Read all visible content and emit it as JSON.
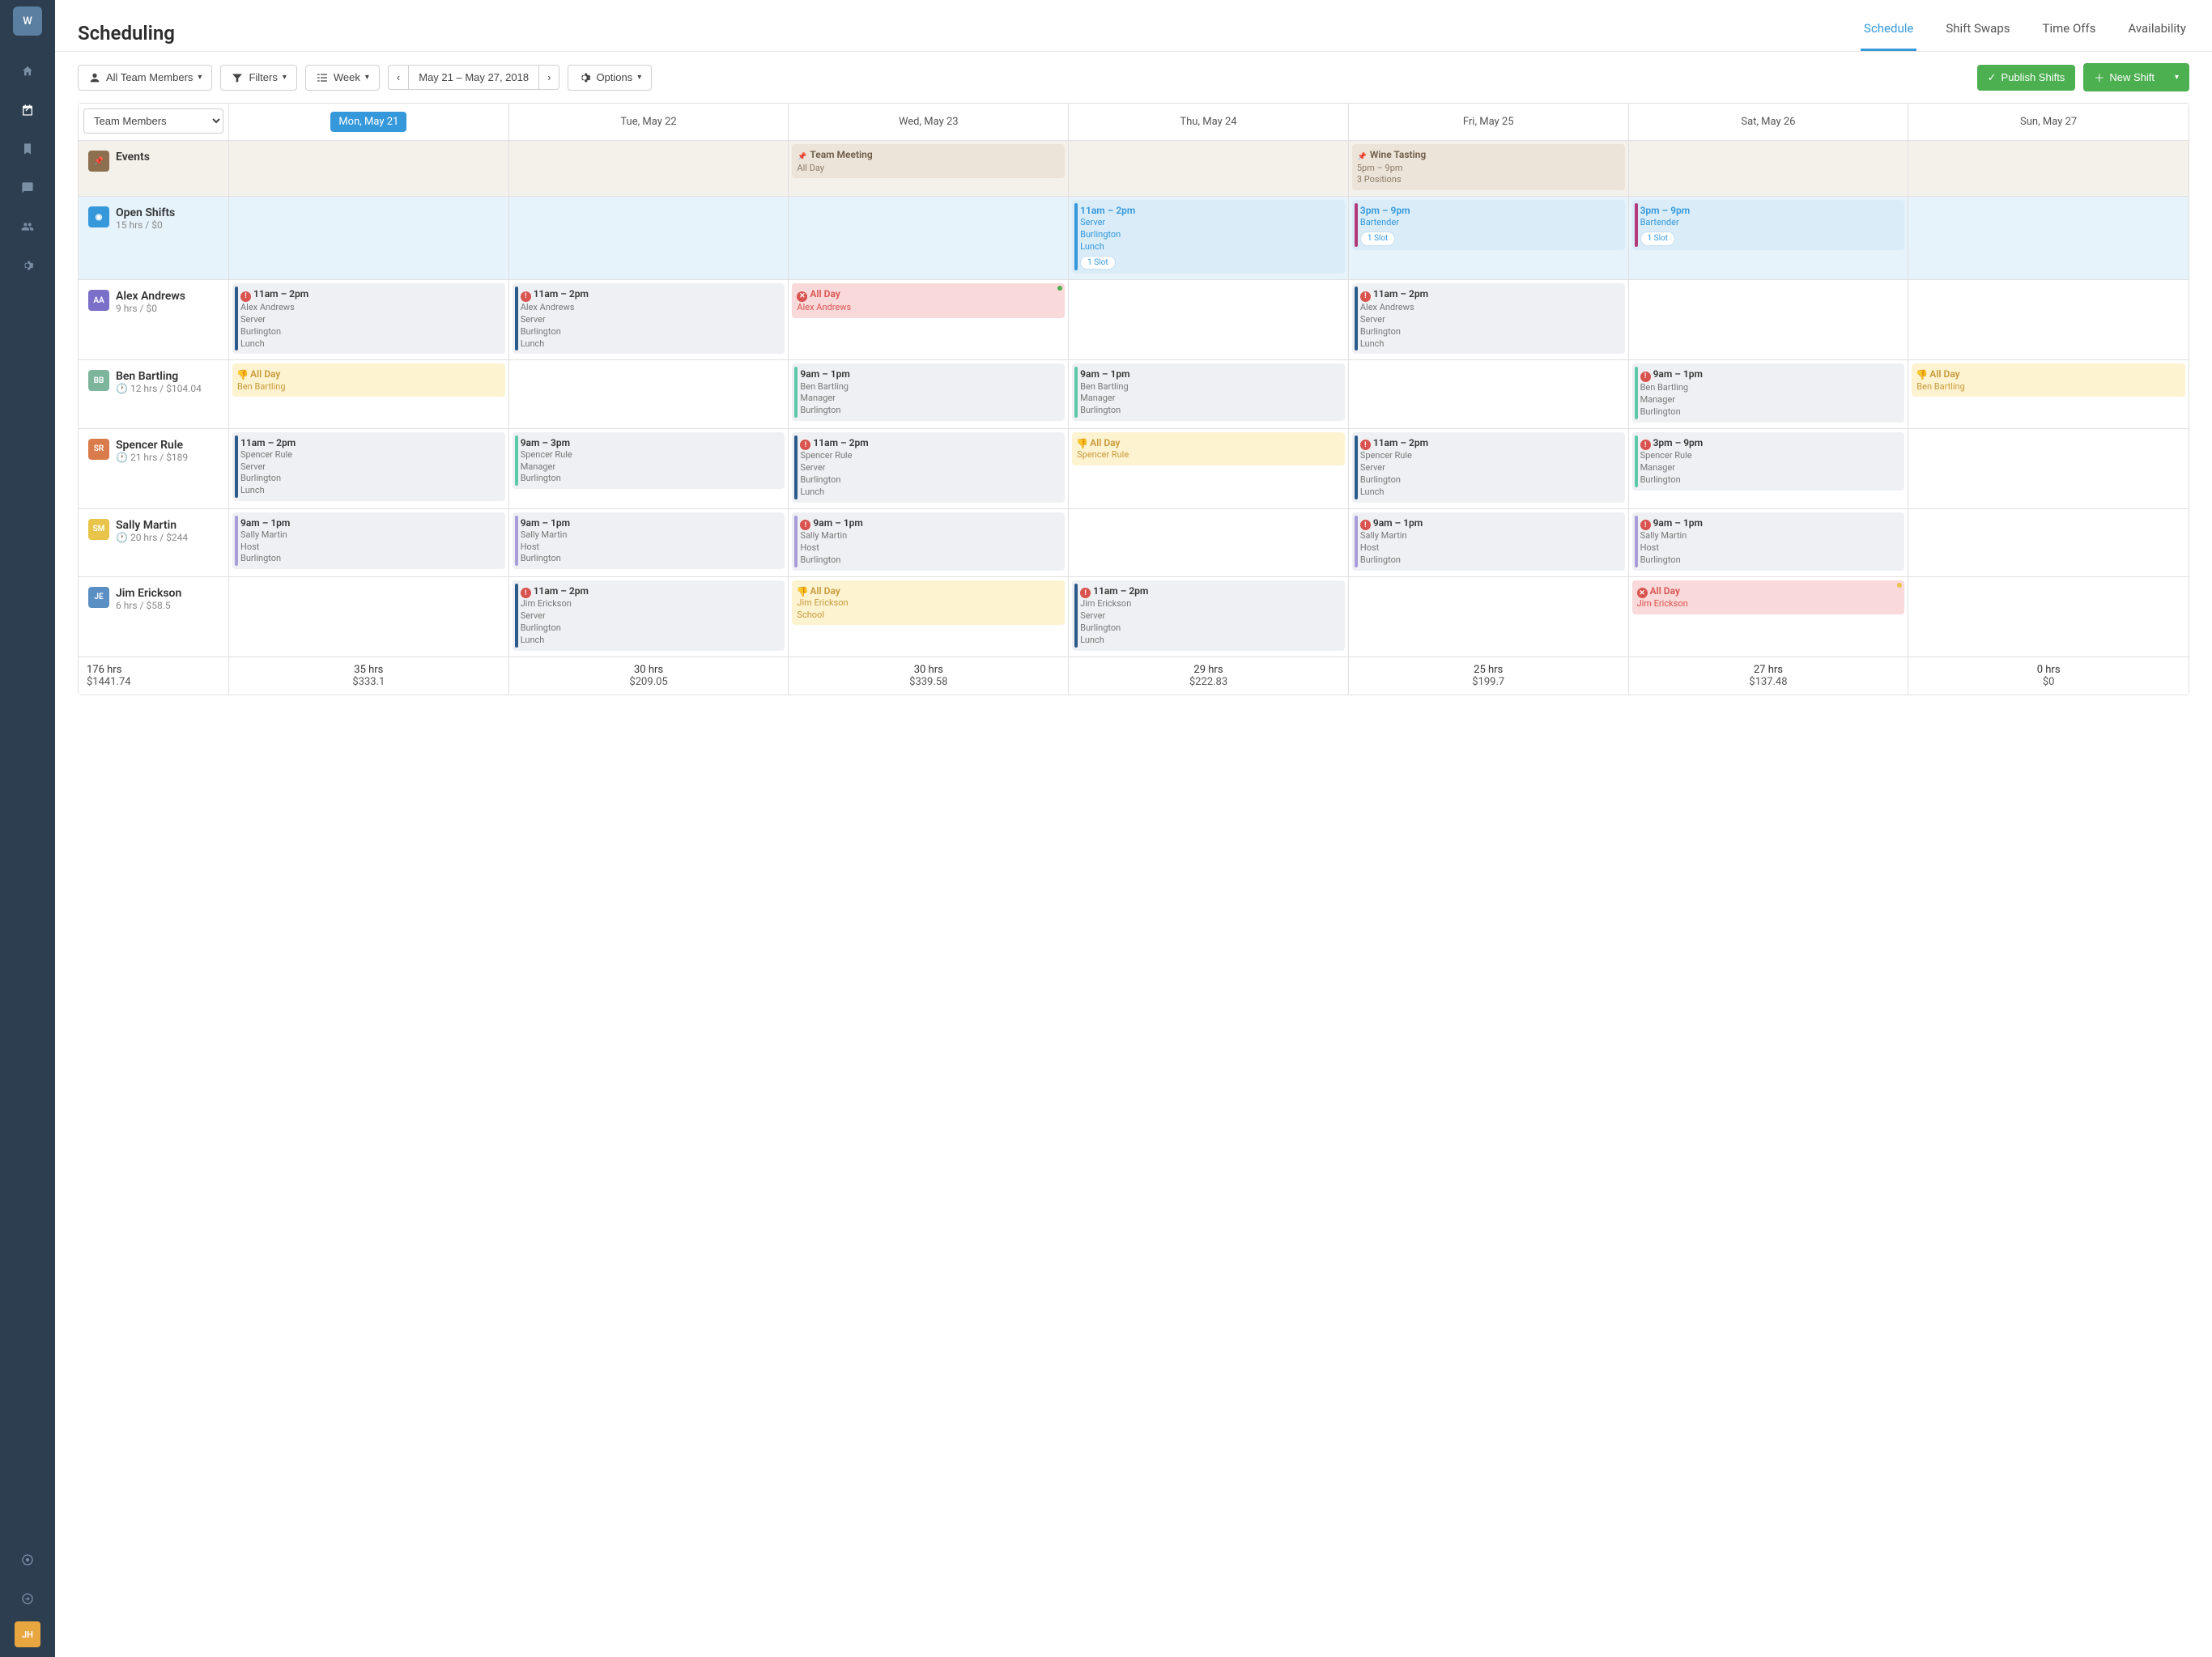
{
  "sidebar": {
    "logo": "W",
    "user_initials": "JH"
  },
  "header": {
    "title": "Scheduling",
    "tabs": [
      "Schedule",
      "Shift Swaps",
      "Time Offs",
      "Availability"
    ],
    "active_tab": 0
  },
  "toolbar": {
    "team_filter": "All Team Members",
    "filters": "Filters",
    "view": "Week",
    "date_range": "May 21 – May 27, 2018",
    "options": "Options",
    "publish": "Publish Shifts",
    "new_shift": "New Shift"
  },
  "columns": {
    "selector": "Team Members",
    "days": [
      "Mon, May 21",
      "Tue, May 22",
      "Wed, May 23",
      "Thu, May 24",
      "Fri, May 25",
      "Sat, May 26",
      "Sun, May 27"
    ],
    "today_index": 0
  },
  "rows": [
    {
      "type": "events",
      "name": "Events",
      "sub": "",
      "cells": [
        null,
        null,
        {
          "style": "brown",
          "noborder": true,
          "icon": "pin",
          "time": "Team Meeting",
          "lines": [
            "All Day"
          ]
        },
        null,
        {
          "style": "brown",
          "noborder": true,
          "icon": "pin",
          "time": "Wine Tasting",
          "lines": [
            "5pm – 9pm",
            "3 Positions"
          ]
        },
        null,
        null
      ]
    },
    {
      "type": "open",
      "name": "Open Shifts",
      "sub": "15 hrs / $0",
      "cells": [
        null,
        null,
        null,
        {
          "style": "blue",
          "bar": "#3498db",
          "time": "11am – 2pm",
          "lines": [
            "Server",
            "Burlington",
            "Lunch"
          ],
          "slot": "1 Slot"
        },
        {
          "style": "blue",
          "bar": "#b23a7a",
          "time": "3pm – 9pm",
          "lines": [
            "Bartender"
          ],
          "slot": "1 Slot"
        },
        {
          "style": "blue",
          "bar": "#b23a7a",
          "time": "3pm – 9pm",
          "lines": [
            "Bartender"
          ],
          "slot": "1 Slot"
        },
        null
      ]
    },
    {
      "type": "member",
      "name": "Alex Andrews",
      "sub": "9 hrs / $0",
      "initials": "AA",
      "color": "#7a6fc9",
      "cells": [
        {
          "style": "gray",
          "bar": "#2c5a8a",
          "icon": "alert",
          "time": "11am – 2pm",
          "lines": [
            "Alex Andrews",
            "Server",
            "Burlington",
            "Lunch"
          ]
        },
        {
          "style": "gray",
          "bar": "#2c5a8a",
          "icon": "alert",
          "time": "11am – 2pm",
          "lines": [
            "Alex Andrews",
            "Server",
            "Burlington",
            "Lunch"
          ]
        },
        {
          "style": "pink",
          "noborder": true,
          "icon": "x",
          "dot": "green",
          "time": "All Day",
          "lines": [
            "Alex Andrews"
          ]
        },
        null,
        {
          "style": "gray",
          "bar": "#2c5a8a",
          "icon": "alert",
          "time": "11am – 2pm",
          "lines": [
            "Alex Andrews",
            "Server",
            "Burlington",
            "Lunch"
          ]
        },
        null,
        null
      ]
    },
    {
      "type": "member",
      "name": "Ben Bartling",
      "sub": "12 hrs / $104.04",
      "sub_icon": "clock",
      "initials": "BB",
      "color": "#7cb49c",
      "cells": [
        {
          "style": "yellow",
          "noborder": true,
          "icon": "thumb",
          "time": "All Day",
          "lines": [
            "Ben Bartling"
          ]
        },
        null,
        {
          "style": "gray",
          "bar": "#5cc9a7",
          "time": "9am – 1pm",
          "lines": [
            "Ben Bartling",
            "Manager",
            "Burlington"
          ]
        },
        {
          "style": "gray",
          "bar": "#5cc9a7",
          "time": "9am – 1pm",
          "lines": [
            "Ben Bartling",
            "Manager",
            "Burlington"
          ]
        },
        null,
        {
          "style": "gray",
          "bar": "#5cc9a7",
          "icon": "alert",
          "time": "9am – 1pm",
          "lines": [
            "Ben Bartling",
            "Manager",
            "Burlington"
          ]
        },
        {
          "style": "yellow",
          "noborder": true,
          "icon": "thumb",
          "time": "All Day",
          "lines": [
            "Ben Bartling"
          ]
        }
      ]
    },
    {
      "type": "member",
      "name": "Spencer Rule",
      "sub": "21 hrs / $189",
      "sub_icon": "clock",
      "initials": "SR",
      "color": "#d97b4a",
      "cells": [
        {
          "style": "gray",
          "bar": "#2c5a8a",
          "time": "11am – 2pm",
          "lines": [
            "Spencer Rule",
            "Server",
            "Burlington",
            "Lunch"
          ]
        },
        {
          "style": "gray",
          "bar": "#5cc9a7",
          "time": "9am – 3pm",
          "lines": [
            "Spencer Rule",
            "Manager",
            "Burlington"
          ]
        },
        {
          "style": "gray",
          "bar": "#2c5a8a",
          "icon": "alert",
          "time": "11am – 2pm",
          "lines": [
            "Spencer Rule",
            "Server",
            "Burlington",
            "Lunch"
          ]
        },
        {
          "style": "yellow",
          "noborder": true,
          "icon": "thumb",
          "time": "All Day",
          "lines": [
            "Spencer Rule"
          ]
        },
        {
          "style": "gray",
          "bar": "#2c5a8a",
          "icon": "alert",
          "time": "11am – 2pm",
          "lines": [
            "Spencer Rule",
            "Server",
            "Burlington",
            "Lunch"
          ]
        },
        {
          "style": "gray",
          "bar": "#5cc9a7",
          "icon": "alert",
          "time": "3pm – 9pm",
          "lines": [
            "Spencer Rule",
            "Manager",
            "Burlington"
          ]
        },
        null
      ]
    },
    {
      "type": "member",
      "name": "Sally Martin",
      "sub": "20 hrs / $244",
      "sub_icon": "clock",
      "initials": "SM",
      "color": "#e8c54a",
      "cells": [
        {
          "style": "gray",
          "bar": "#a89cd9",
          "time": "9am – 1pm",
          "lines": [
            "Sally Martin",
            "Host",
            "Burlington"
          ]
        },
        {
          "style": "gray",
          "bar": "#a89cd9",
          "time": "9am – 1pm",
          "lines": [
            "Sally Martin",
            "Host",
            "Burlington"
          ]
        },
        {
          "style": "gray",
          "bar": "#a89cd9",
          "icon": "alert",
          "time": "9am – 1pm",
          "lines": [
            "Sally Martin",
            "Host",
            "Burlington"
          ]
        },
        null,
        {
          "style": "gray",
          "bar": "#a89cd9",
          "icon": "alert",
          "time": "9am – 1pm",
          "lines": [
            "Sally Martin",
            "Host",
            "Burlington"
          ]
        },
        {
          "style": "gray",
          "bar": "#a89cd9",
          "icon": "alert",
          "time": "9am – 1pm",
          "lines": [
            "Sally Martin",
            "Host",
            "Burlington"
          ]
        },
        null
      ]
    },
    {
      "type": "member",
      "name": "Jim Erickson",
      "sub": "6 hrs / $58.5",
      "initials": "JE",
      "color": "#5a8fc4",
      "cells": [
        null,
        {
          "style": "gray",
          "bar": "#2c5a8a",
          "icon": "alert",
          "time": "11am – 2pm",
          "lines": [
            "Jim Erickson",
            "Server",
            "Burlington",
            "Lunch"
          ]
        },
        {
          "style": "yellow",
          "noborder": true,
          "icon": "thumb",
          "time": "All Day",
          "lines": [
            "Jim Erickson",
            "School"
          ]
        },
        {
          "style": "gray",
          "bar": "#2c5a8a",
          "icon": "alert",
          "time": "11am – 2pm",
          "lines": [
            "Jim Erickson",
            "Server",
            "Burlington",
            "Lunch"
          ]
        },
        null,
        {
          "style": "pink",
          "noborder": true,
          "icon": "x",
          "dot": "yellow",
          "time": "All Day",
          "lines": [
            "Jim Erickson"
          ]
        },
        null
      ]
    }
  ],
  "totals": {
    "overall": {
      "hrs": "176 hrs",
      "cost": "$1441.74"
    },
    "days": [
      {
        "hrs": "35 hrs",
        "cost": "$333.1"
      },
      {
        "hrs": "30 hrs",
        "cost": "$209.05"
      },
      {
        "hrs": "30 hrs",
        "cost": "$339.58"
      },
      {
        "hrs": "29 hrs",
        "cost": "$222.83"
      },
      {
        "hrs": "25 hrs",
        "cost": "$199.7"
      },
      {
        "hrs": "27 hrs",
        "cost": "$137.48"
      },
      {
        "hrs": "0 hrs",
        "cost": "$0"
      }
    ]
  }
}
